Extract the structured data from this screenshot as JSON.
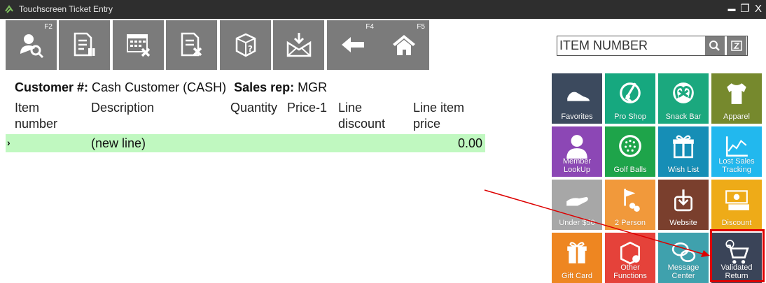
{
  "window": {
    "title": "Touchscreen Ticket Entry",
    "minimize": "▬",
    "restore": "❐",
    "close": "X"
  },
  "toolbar": {
    "buttons": [
      {
        "name": "customer-lookup",
        "key": "F2",
        "icon": "user-search-icon"
      },
      {
        "name": "ticket",
        "key": "",
        "icon": "document-pause-icon"
      },
      {
        "name": "calendar-cancel",
        "key": "",
        "icon": "calendar-x-icon"
      },
      {
        "name": "void-ticket",
        "key": "",
        "icon": "document-x-icon"
      },
      {
        "name": "package",
        "key": "",
        "icon": "box-question-icon"
      },
      {
        "name": "receive",
        "key": "",
        "icon": "mail-download-icon"
      },
      {
        "name": "back",
        "key": "F4",
        "icon": "arrow-left-icon"
      },
      {
        "name": "home",
        "key": "F5",
        "icon": "home-icon"
      }
    ]
  },
  "search": {
    "value": "ITEM NUMBER"
  },
  "ticket": {
    "customer_label": "Customer #:",
    "customer_value": "Cash Customer (CASH)",
    "salesrep_label": "Sales rep:",
    "salesrep_value": "MGR",
    "columns": [
      "Item number",
      "Description",
      "Quantity",
      "Price-1",
      "Line discount",
      "Line item price"
    ],
    "new_line": {
      "marker": "›",
      "description": "(new line)",
      "total": "0.00"
    }
  },
  "tiles": [
    {
      "label": "Favorites",
      "color": "#3c4a5e",
      "icon": "shoe-icon"
    },
    {
      "label": "Pro Shop",
      "color": "#16a87f",
      "icon": "golf-club-icon"
    },
    {
      "label": "Snack Bar",
      "color": "#1ba87e",
      "icon": "pretzel-icon"
    },
    {
      "label": "Apparel",
      "color": "#76892d",
      "icon": "shirt-icon"
    },
    {
      "label": "Member LookUp",
      "color": "#8c47b5",
      "icon": "member-icon"
    },
    {
      "label": "Golf Balls",
      "color": "#1ea44a",
      "icon": "golf-ball-icon"
    },
    {
      "label": "Wish List",
      "color": "#168eb6",
      "icon": "gift-box-icon"
    },
    {
      "label": "Lost Sales Tracking",
      "color": "#22b8ee",
      "icon": "chart-icon"
    },
    {
      "label": "Under $50",
      "color": "#a7a7a7",
      "icon": "hand-money-icon"
    },
    {
      "label": "2 Person",
      "color": "#f1993b",
      "icon": "flag-icon"
    },
    {
      "label": "Website",
      "color": "#7a3f2d",
      "icon": "touch-icon"
    },
    {
      "label": "Discount",
      "color": "#eeab18",
      "icon": "money-icon"
    },
    {
      "label": "Gift Card",
      "color": "#ee8621",
      "icon": "gift-icon"
    },
    {
      "label": "Other Functions",
      "color": "#e5423a",
      "icon": "box-gear-icon"
    },
    {
      "label": "Message Center",
      "color": "#3fa1ad",
      "icon": "chat-icon"
    },
    {
      "label": "Validated Return",
      "color": "#3a4458",
      "icon": "cart-return-icon"
    }
  ]
}
